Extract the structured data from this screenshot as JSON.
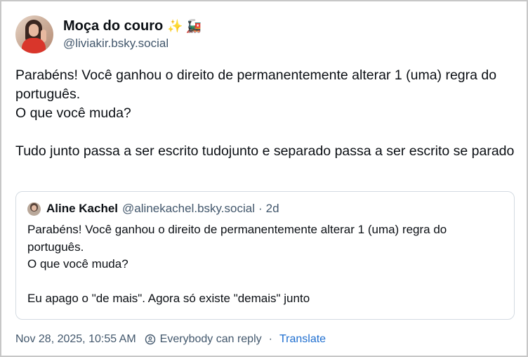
{
  "author": {
    "display_name": "Moça do couro",
    "emoji_sparkles": "✨",
    "emoji_train": "🚂",
    "handle": "@liviakir.bsky.social",
    "avatar_icon": "profile-photo"
  },
  "post": {
    "lines": [
      "Parabéns! Você ganhou o direito de permanentemente alterar 1 (uma) regra do português.",
      "O que você muda?",
      "",
      "Tudo junto passa a ser escrito tudojunto e separado passa a ser escrito se parado"
    ]
  },
  "quote": {
    "display_name": "Aline Kachel",
    "handle": "@alinekachel.bsky.social",
    "separator": "·",
    "time": "2d",
    "lines": [
      "Parabéns! Você ganhou o direito de permanentemente alterar 1 (uma) regra do português.",
      "O que você muda?",
      "",
      "Eu apago o \"de mais\". Agora só existe \"demais\" junto"
    ]
  },
  "footer": {
    "timestamp": "Nov 28, 2025, 10:55 AM",
    "reply_setting": "Everybody can reply",
    "separator": "·",
    "translate_label": "Translate"
  },
  "colors": {
    "text": "#0b0f14",
    "muted": "#42576c",
    "link": "#1f6fd0",
    "border": "#d4dbe2"
  }
}
